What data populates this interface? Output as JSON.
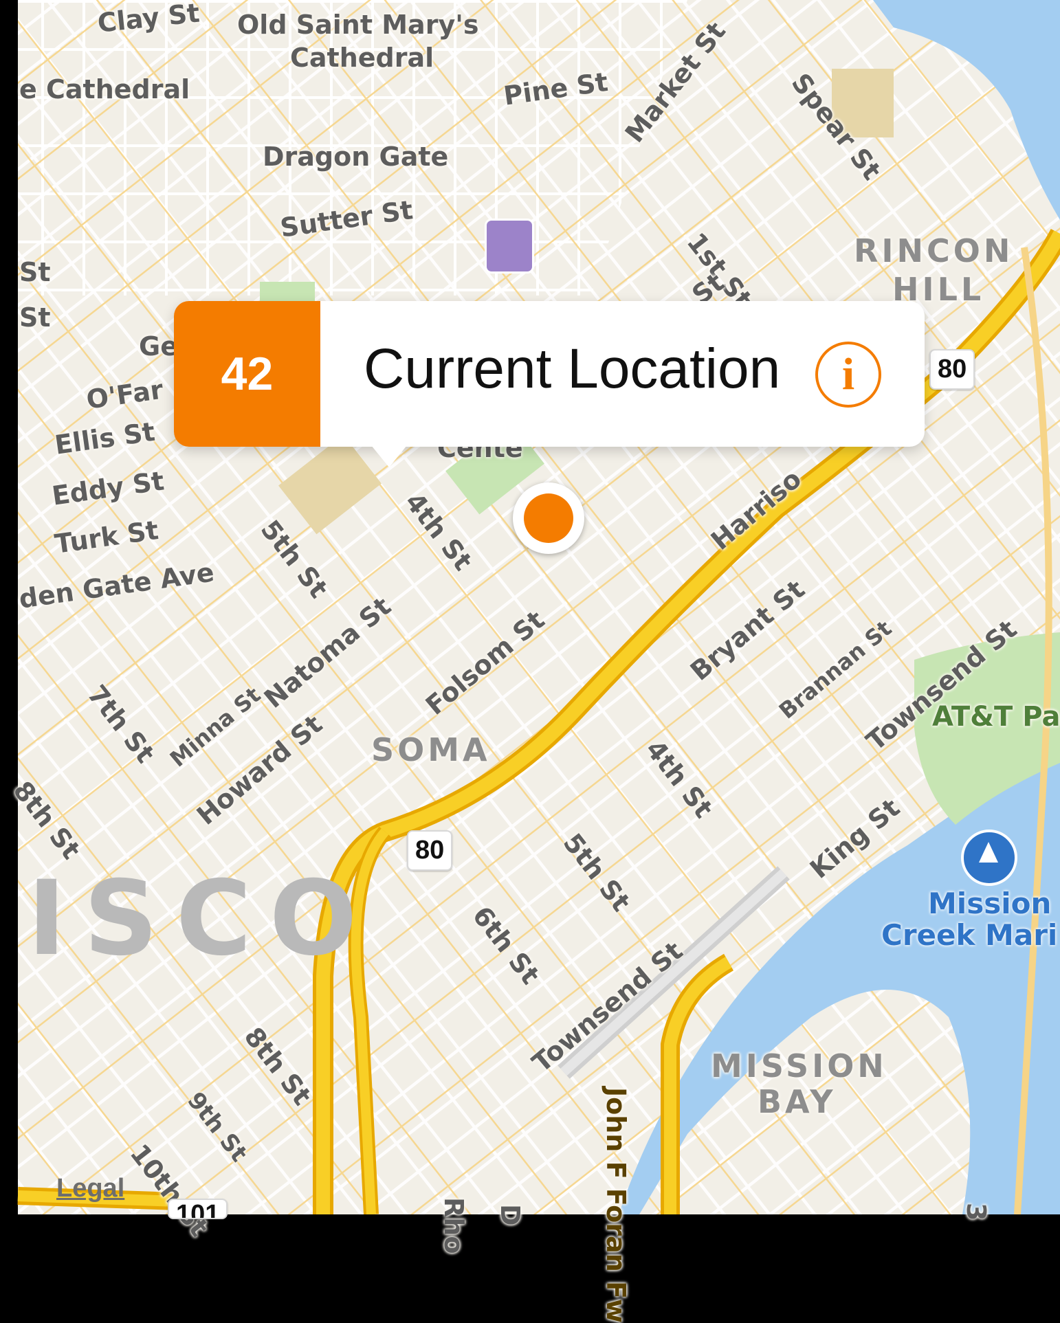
{
  "map": {
    "streets": [
      {
        "id": "clay",
        "label": "Clay St"
      },
      {
        "id": "old-st-marys",
        "label": "Old Saint Mary's"
      },
      {
        "id": "old-st-marys-2",
        "label": "Cathedral"
      },
      {
        "id": "cathedral",
        "label": "e Cathedral"
      },
      {
        "id": "pine",
        "label": "Pine St"
      },
      {
        "id": "market",
        "label": "Market St"
      },
      {
        "id": "spear",
        "label": "Spear St"
      },
      {
        "id": "dragon-gate",
        "label": "Dragon Gate"
      },
      {
        "id": "sutter",
        "label": "Sutter St"
      },
      {
        "id": "first",
        "label": "1st St"
      },
      {
        "id": "first-b",
        "label": "St"
      },
      {
        "id": "st-left-1",
        "label": "St"
      },
      {
        "id": "st-left-2",
        "label": "St"
      },
      {
        "id": "geary",
        "label": "Ge"
      },
      {
        "id": "ofarrell",
        "label": "O'Far"
      },
      {
        "id": "ellis",
        "label": "Ellis St"
      },
      {
        "id": "eddy",
        "label": "Eddy St"
      },
      {
        "id": "turk",
        "label": "Turk St"
      },
      {
        "id": "golden-gate",
        "label": "den Gate Ave"
      },
      {
        "id": "fifth-a",
        "label": "5th St"
      },
      {
        "id": "fourth-a",
        "label": "4th St"
      },
      {
        "id": "harrison",
        "label": "Harriso"
      },
      {
        "id": "natoma",
        "label": "Natoma St"
      },
      {
        "id": "folsom",
        "label": "Folsom St"
      },
      {
        "id": "bryant",
        "label": "Bryant St"
      },
      {
        "id": "brannan",
        "label": "Brannan St"
      },
      {
        "id": "townsend-a",
        "label": "Townsend St"
      },
      {
        "id": "seventh",
        "label": "7th St"
      },
      {
        "id": "minna",
        "label": "Minna St"
      },
      {
        "id": "howard",
        "label": "Howard St"
      },
      {
        "id": "eighth-a",
        "label": "8th St"
      },
      {
        "id": "fourth-b",
        "label": "4th St"
      },
      {
        "id": "king",
        "label": "King St"
      },
      {
        "id": "fifth-b",
        "label": "5th St"
      },
      {
        "id": "sixth",
        "label": "6th St"
      },
      {
        "id": "townsend-b",
        "label": "Townsend St"
      },
      {
        "id": "eighth-b",
        "label": "8th St"
      },
      {
        "id": "ninth",
        "label": "9th St"
      },
      {
        "id": "tenth",
        "label": "10th St"
      },
      {
        "id": "john-f-foran",
        "label": "John F Foran Fw"
      },
      {
        "id": "rhode",
        "label": "Rho"
      },
      {
        "id": "d-street",
        "label": "D"
      },
      {
        "id": "third",
        "label": "3"
      },
      {
        "id": "centre",
        "label": "Cente"
      }
    ],
    "districts": [
      {
        "id": "rincon",
        "label": "RINCON"
      },
      {
        "id": "hill",
        "label": "HILL"
      },
      {
        "id": "soma",
        "label": "SOMA"
      },
      {
        "id": "mission",
        "label": "MISSION"
      },
      {
        "id": "bay",
        "label": "BAY"
      }
    ],
    "city_fragment": "ISCO",
    "pois": {
      "att_park": "AT&T Pa",
      "marina_line1": "Mission",
      "marina_line2": "Creek Mari"
    },
    "highway_shields": {
      "i80_top": "80",
      "i80_mid": "80",
      "us101": "101"
    },
    "legal": "Legal",
    "icons": [
      "transit-station-icon",
      "marina-sailboat-icon",
      "current-location-dot-icon",
      "info-icon"
    ]
  },
  "callout": {
    "badge": "42",
    "title": "Current Location",
    "info_glyph": "i"
  },
  "colors": {
    "accent": "#f47c00",
    "water": "#a3cdf1",
    "park": "#c7e5b3",
    "land": "#f4f1ea",
    "highway": "#f6c100",
    "marina": "#2f74c7"
  }
}
